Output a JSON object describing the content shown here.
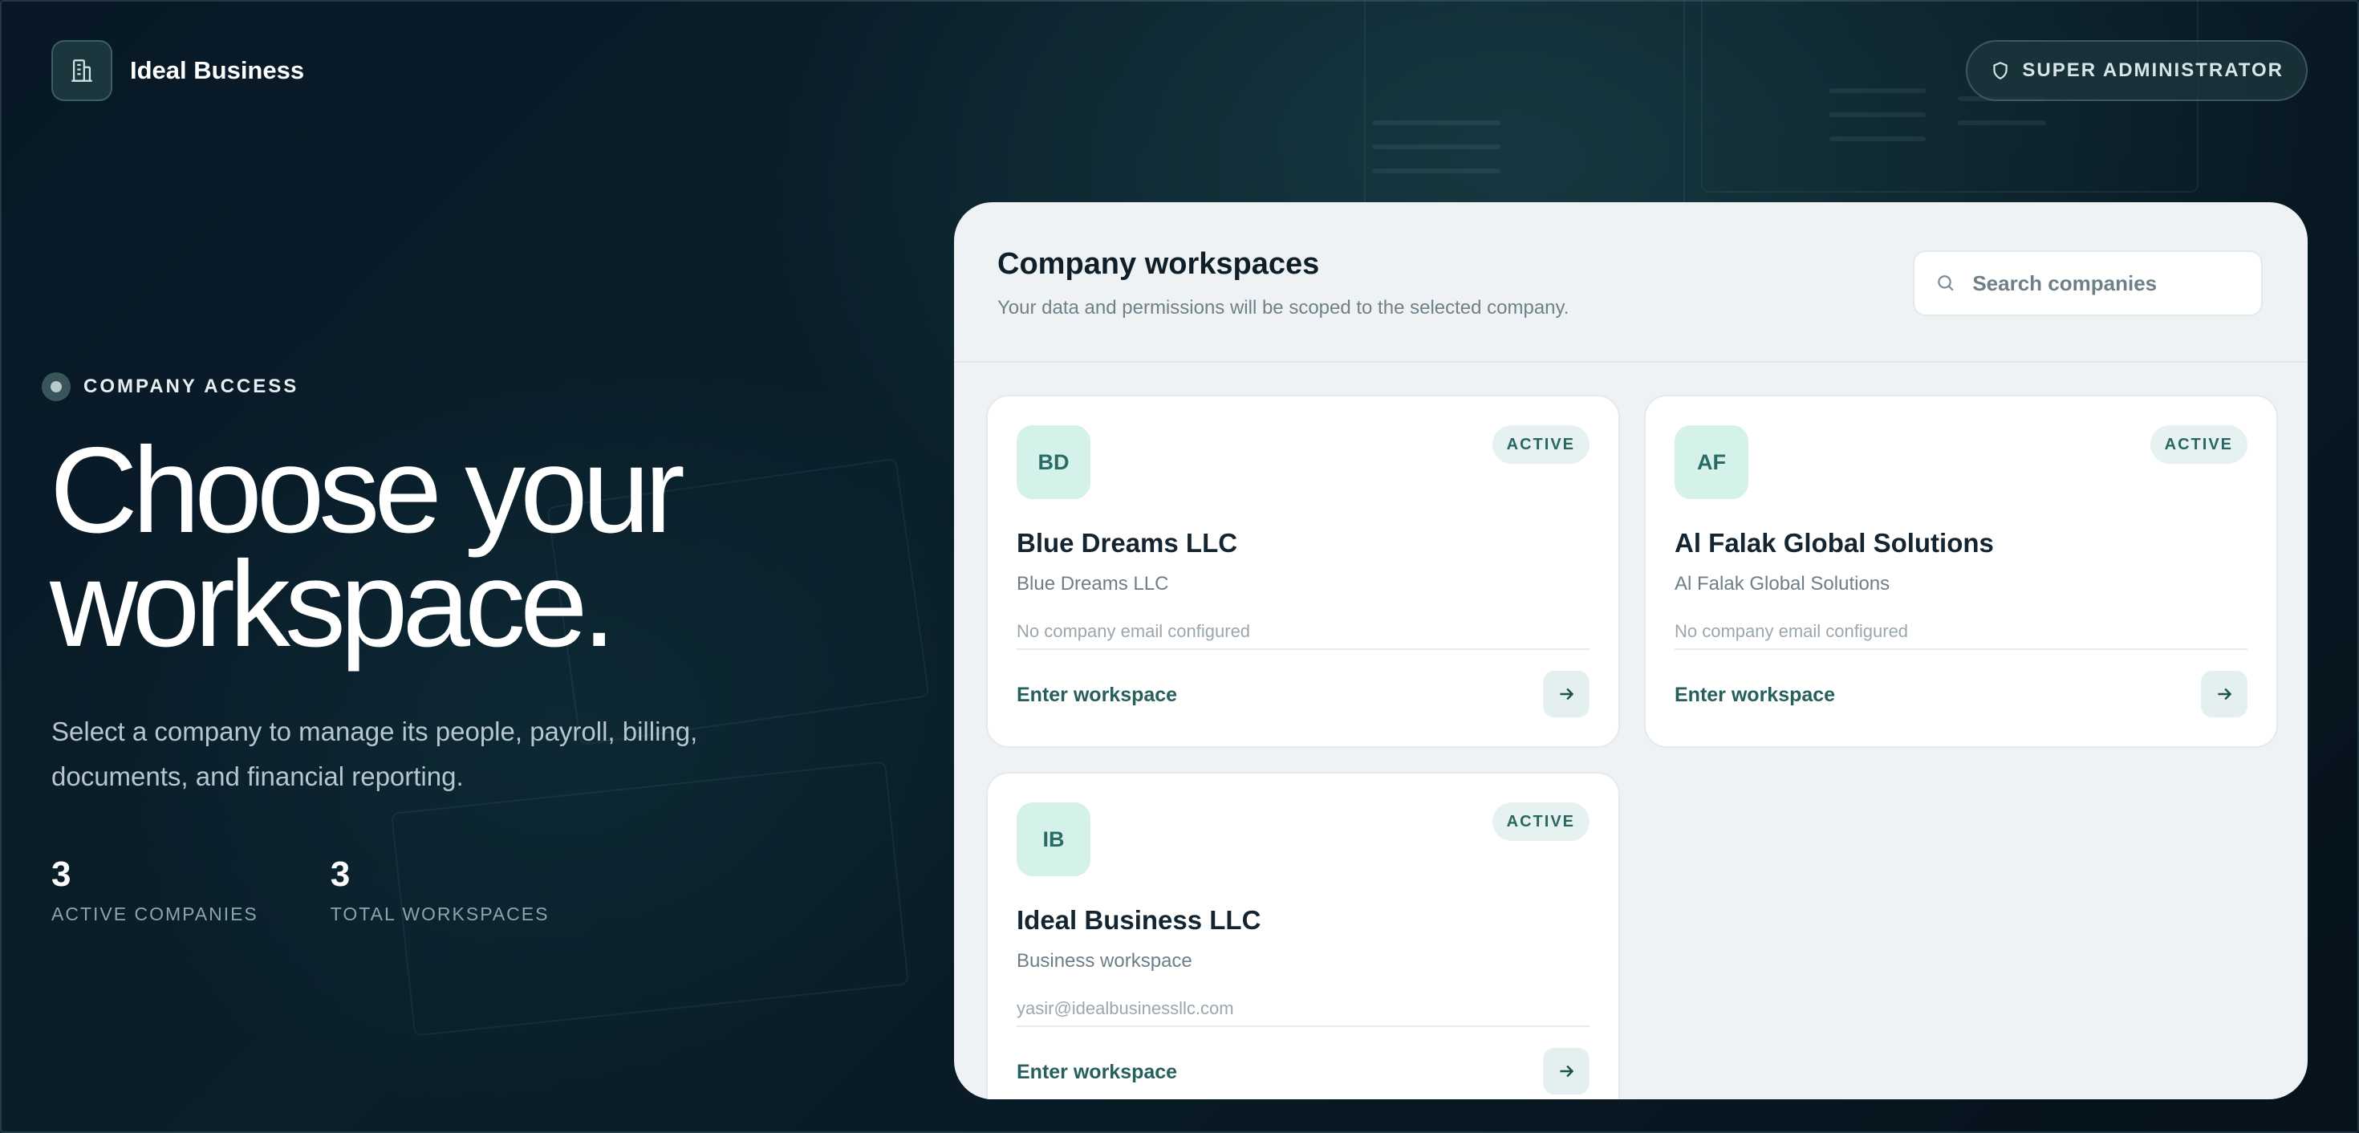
{
  "header": {
    "brand_name": "Ideal Business",
    "brand_icon": "building-icon",
    "role_label": "SUPER ADMINISTRATOR",
    "role_icon": "shield-icon"
  },
  "hero": {
    "eyebrow": "COMPANY ACCESS",
    "title_line1": "Choose your",
    "title_line2": "workspace.",
    "subtitle": "Select a company to manage its people, payroll, billing, documents, and financial reporting.",
    "stats": [
      {
        "value": "3",
        "label": "ACTIVE COMPANIES"
      },
      {
        "value": "3",
        "label": "TOTAL WORKSPACES"
      }
    ]
  },
  "panel": {
    "title": "Company workspaces",
    "subtitle": "Your data and permissions will be scoped to the selected company.",
    "search": {
      "placeholder": "Search companies",
      "value": "",
      "icon": "search-icon"
    }
  },
  "companies": [
    {
      "initials": "BD",
      "status": "ACTIVE",
      "name": "Blue Dreams LLC",
      "description": "Blue Dreams LLC",
      "email": "No company email configured",
      "action": "Enter workspace",
      "action_icon": "arrow-right-icon"
    },
    {
      "initials": "AF",
      "status": "ACTIVE",
      "name": "Al Falak Global Solutions",
      "description": "Al Falak Global Solutions",
      "email": "No company email configured",
      "action": "Enter workspace",
      "action_icon": "arrow-right-icon"
    },
    {
      "initials": "IB",
      "status": "ACTIVE",
      "name": "Ideal Business LLC",
      "description": "Business workspace",
      "email": "yasir@idealbusinessllc.com",
      "action": "Enter workspace",
      "action_icon": "arrow-right-icon"
    }
  ],
  "colors": {
    "background": "#07131d",
    "panel": "#eff2f4",
    "accent": "#25605c",
    "avatar_bg": "#d4f1ea",
    "badge_bg": "#e5f2f1"
  }
}
